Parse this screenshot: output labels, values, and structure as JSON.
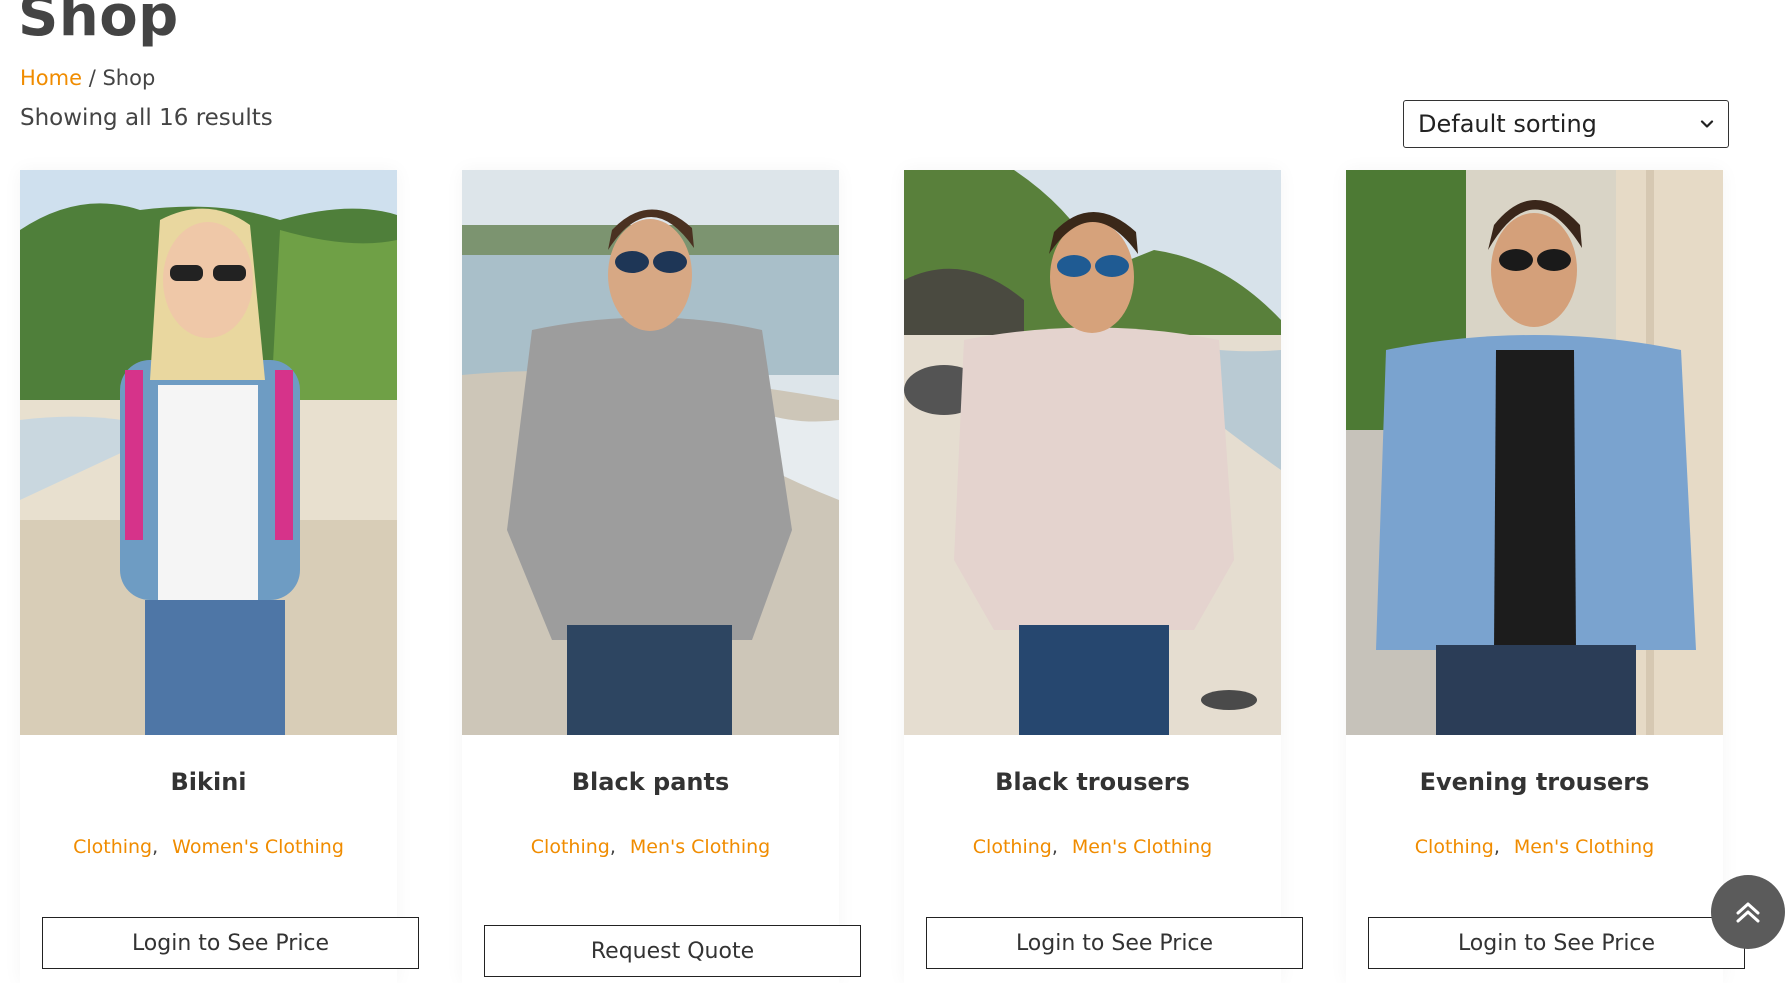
{
  "page": {
    "title": "Shop"
  },
  "breadcrumb": {
    "home": "Home",
    "separator": "/",
    "current": "Shop"
  },
  "results": {
    "text": "Showing all 16 results"
  },
  "sorting": {
    "selected": "Default sorting",
    "icon": "chevron-down-icon"
  },
  "products": [
    {
      "title": "Bikini",
      "categories": [
        "Clothing",
        "Women's Clothing"
      ],
      "button": "Login to See Price"
    },
    {
      "title": "Black pants",
      "categories": [
        "Clothing",
        "Men's Clothing"
      ],
      "button": "Request Quote"
    },
    {
      "title": "Black trousers",
      "categories": [
        "Clothing",
        "Men's Clothing"
      ],
      "button": "Login to See Price"
    },
    {
      "title": "Evening trousers",
      "categories": [
        "Clothing",
        "Men's Clothing"
      ],
      "button": "Login to See Price"
    }
  ],
  "scroll_top": {
    "icon": "double-chevron-up-icon"
  },
  "colors": {
    "accent": "#f08c00",
    "text": "#444444",
    "button_border": "#222222",
    "scroll_button": "#5b5b5b"
  }
}
